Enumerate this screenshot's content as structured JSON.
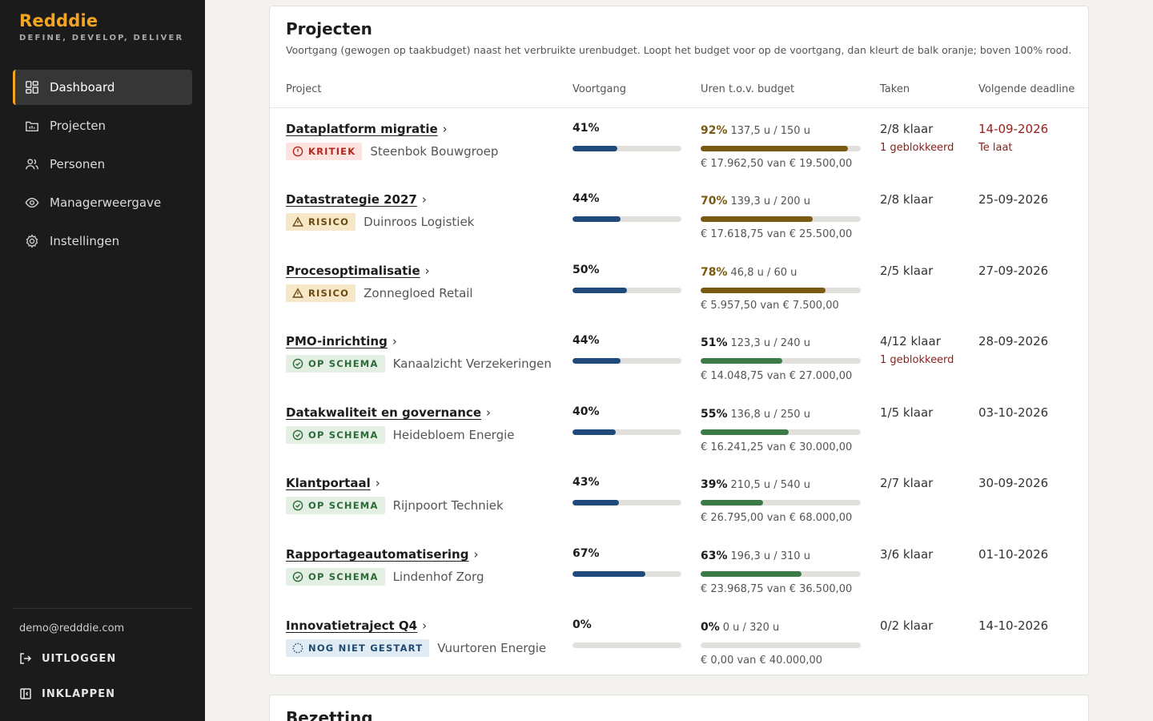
{
  "brand": {
    "name": "Redddie",
    "tagline": "DEFINE, DEVELOP, DELIVER"
  },
  "nav": [
    {
      "label": "Dashboard",
      "icon": "dashboard-icon",
      "active": true
    },
    {
      "label": "Projecten",
      "icon": "projects-icon",
      "active": false
    },
    {
      "label": "Personen",
      "icon": "people-icon",
      "active": false
    },
    {
      "label": "Managerweergave",
      "icon": "eye-icon",
      "active": false
    },
    {
      "label": "Instellingen",
      "icon": "gear-icon",
      "active": false
    }
  ],
  "user": {
    "email": "demo@redddie.com"
  },
  "actions": {
    "logout": "UITLOGGEN",
    "collapse": "INKLAPPEN"
  },
  "colors": {
    "accent": "#f5a524",
    "progress": "#1f4a7a",
    "budget_over": "#7a5a10",
    "budget_ok": "#3c7a48"
  },
  "projects_card": {
    "title": "Projecten",
    "subtitle": "Voortgang (gewogen op taakbudget) naast het verbruikte urenbudget. Loopt het budget voor op de voortgang, dan kleurt de balk oranje; boven 100% rood.",
    "headers": {
      "project": "Project",
      "progress": "Voortgang",
      "hours": "Uren t.o.v. budget",
      "tasks": "Taken",
      "deadline": "Volgende deadline"
    },
    "rows": [
      {
        "name": "Dataplatform migratie",
        "status": "KRITIEK",
        "status_type": "kritiek",
        "client": "Steenbok Bouwgroep",
        "progress_label": "41%",
        "progress": 41,
        "budget_label": "92%",
        "budget": 92,
        "budget_state": "over",
        "hours": "137,5 u / 150 u",
        "money": "€ 17.962,50 van € 19.500,00",
        "tasks": "2/8 klaar",
        "blocked": "1 geblokkeerd",
        "deadline": "14-09-2026",
        "late": "Te laat"
      },
      {
        "name": "Datastrategie 2027",
        "status": "RISICO",
        "status_type": "risico",
        "client": "Duinroos Logistiek",
        "progress_label": "44%",
        "progress": 44,
        "budget_label": "70%",
        "budget": 70,
        "budget_state": "over",
        "hours": "139,3 u / 200 u",
        "money": "€ 17.618,75 van € 25.500,00",
        "tasks": "2/8 klaar",
        "blocked": "",
        "deadline": "25-09-2026",
        "late": ""
      },
      {
        "name": "Procesoptimalisatie",
        "status": "RISICO",
        "status_type": "risico",
        "client": "Zonnegloed Retail",
        "progress_label": "50%",
        "progress": 50,
        "budget_label": "78%",
        "budget": 78,
        "budget_state": "over",
        "hours": "46,8 u / 60 u",
        "money": "€ 5.957,50 van € 7.500,00",
        "tasks": "2/5 klaar",
        "blocked": "",
        "deadline": "27-09-2026",
        "late": ""
      },
      {
        "name": "PMO-inrichting",
        "status": "OP SCHEMA",
        "status_type": "schema",
        "client": "Kanaalzicht Verzekeringen",
        "progress_label": "44%",
        "progress": 44,
        "budget_label": "51%",
        "budget": 51,
        "budget_state": "ok",
        "hours": "123,3 u / 240 u",
        "money": "€ 14.048,75 van € 27.000,00",
        "tasks": "4/12 klaar",
        "blocked": "1 geblokkeerd",
        "deadline": "28-09-2026",
        "late": ""
      },
      {
        "name": "Datakwaliteit en governance",
        "status": "OP SCHEMA",
        "status_type": "schema",
        "client": "Heidebloem Energie",
        "progress_label": "40%",
        "progress": 40,
        "budget_label": "55%",
        "budget": 55,
        "budget_state": "ok",
        "hours": "136,8 u / 250 u",
        "money": "€ 16.241,25 van € 30.000,00",
        "tasks": "1/5 klaar",
        "blocked": "",
        "deadline": "03-10-2026",
        "late": ""
      },
      {
        "name": "Klantportaal",
        "status": "OP SCHEMA",
        "status_type": "schema",
        "client": "Rijnpoort Techniek",
        "progress_label": "43%",
        "progress": 43,
        "budget_label": "39%",
        "budget": 39,
        "budget_state": "ok",
        "hours": "210,5 u / 540 u",
        "money": "€ 26.795,00 van € 68.000,00",
        "tasks": "2/7 klaar",
        "blocked": "",
        "deadline": "30-09-2026",
        "late": ""
      },
      {
        "name": "Rapportageautomatisering",
        "status": "OP SCHEMA",
        "status_type": "schema",
        "client": "Lindenhof Zorg",
        "progress_label": "67%",
        "progress": 67,
        "budget_label": "63%",
        "budget": 63,
        "budget_state": "ok",
        "hours": "196,3 u / 310 u",
        "money": "€ 23.968,75 van € 36.500,00",
        "tasks": "3/6 klaar",
        "blocked": "",
        "deadline": "01-10-2026",
        "late": ""
      },
      {
        "name": "Innovatietraject Q4",
        "status": "NOG NIET GESTART",
        "status_type": "niet",
        "client": "Vuurtoren Energie",
        "progress_label": "0%",
        "progress": 0,
        "budget_label": "0%",
        "budget": 0,
        "budget_state": "ok",
        "hours": "0 u / 320 u",
        "money": "€ 0,00 van € 40.000,00",
        "tasks": "0/2 klaar",
        "blocked": "",
        "deadline": "14-10-2026",
        "late": ""
      }
    ]
  },
  "bezetting_card": {
    "title": "Bezetting"
  }
}
